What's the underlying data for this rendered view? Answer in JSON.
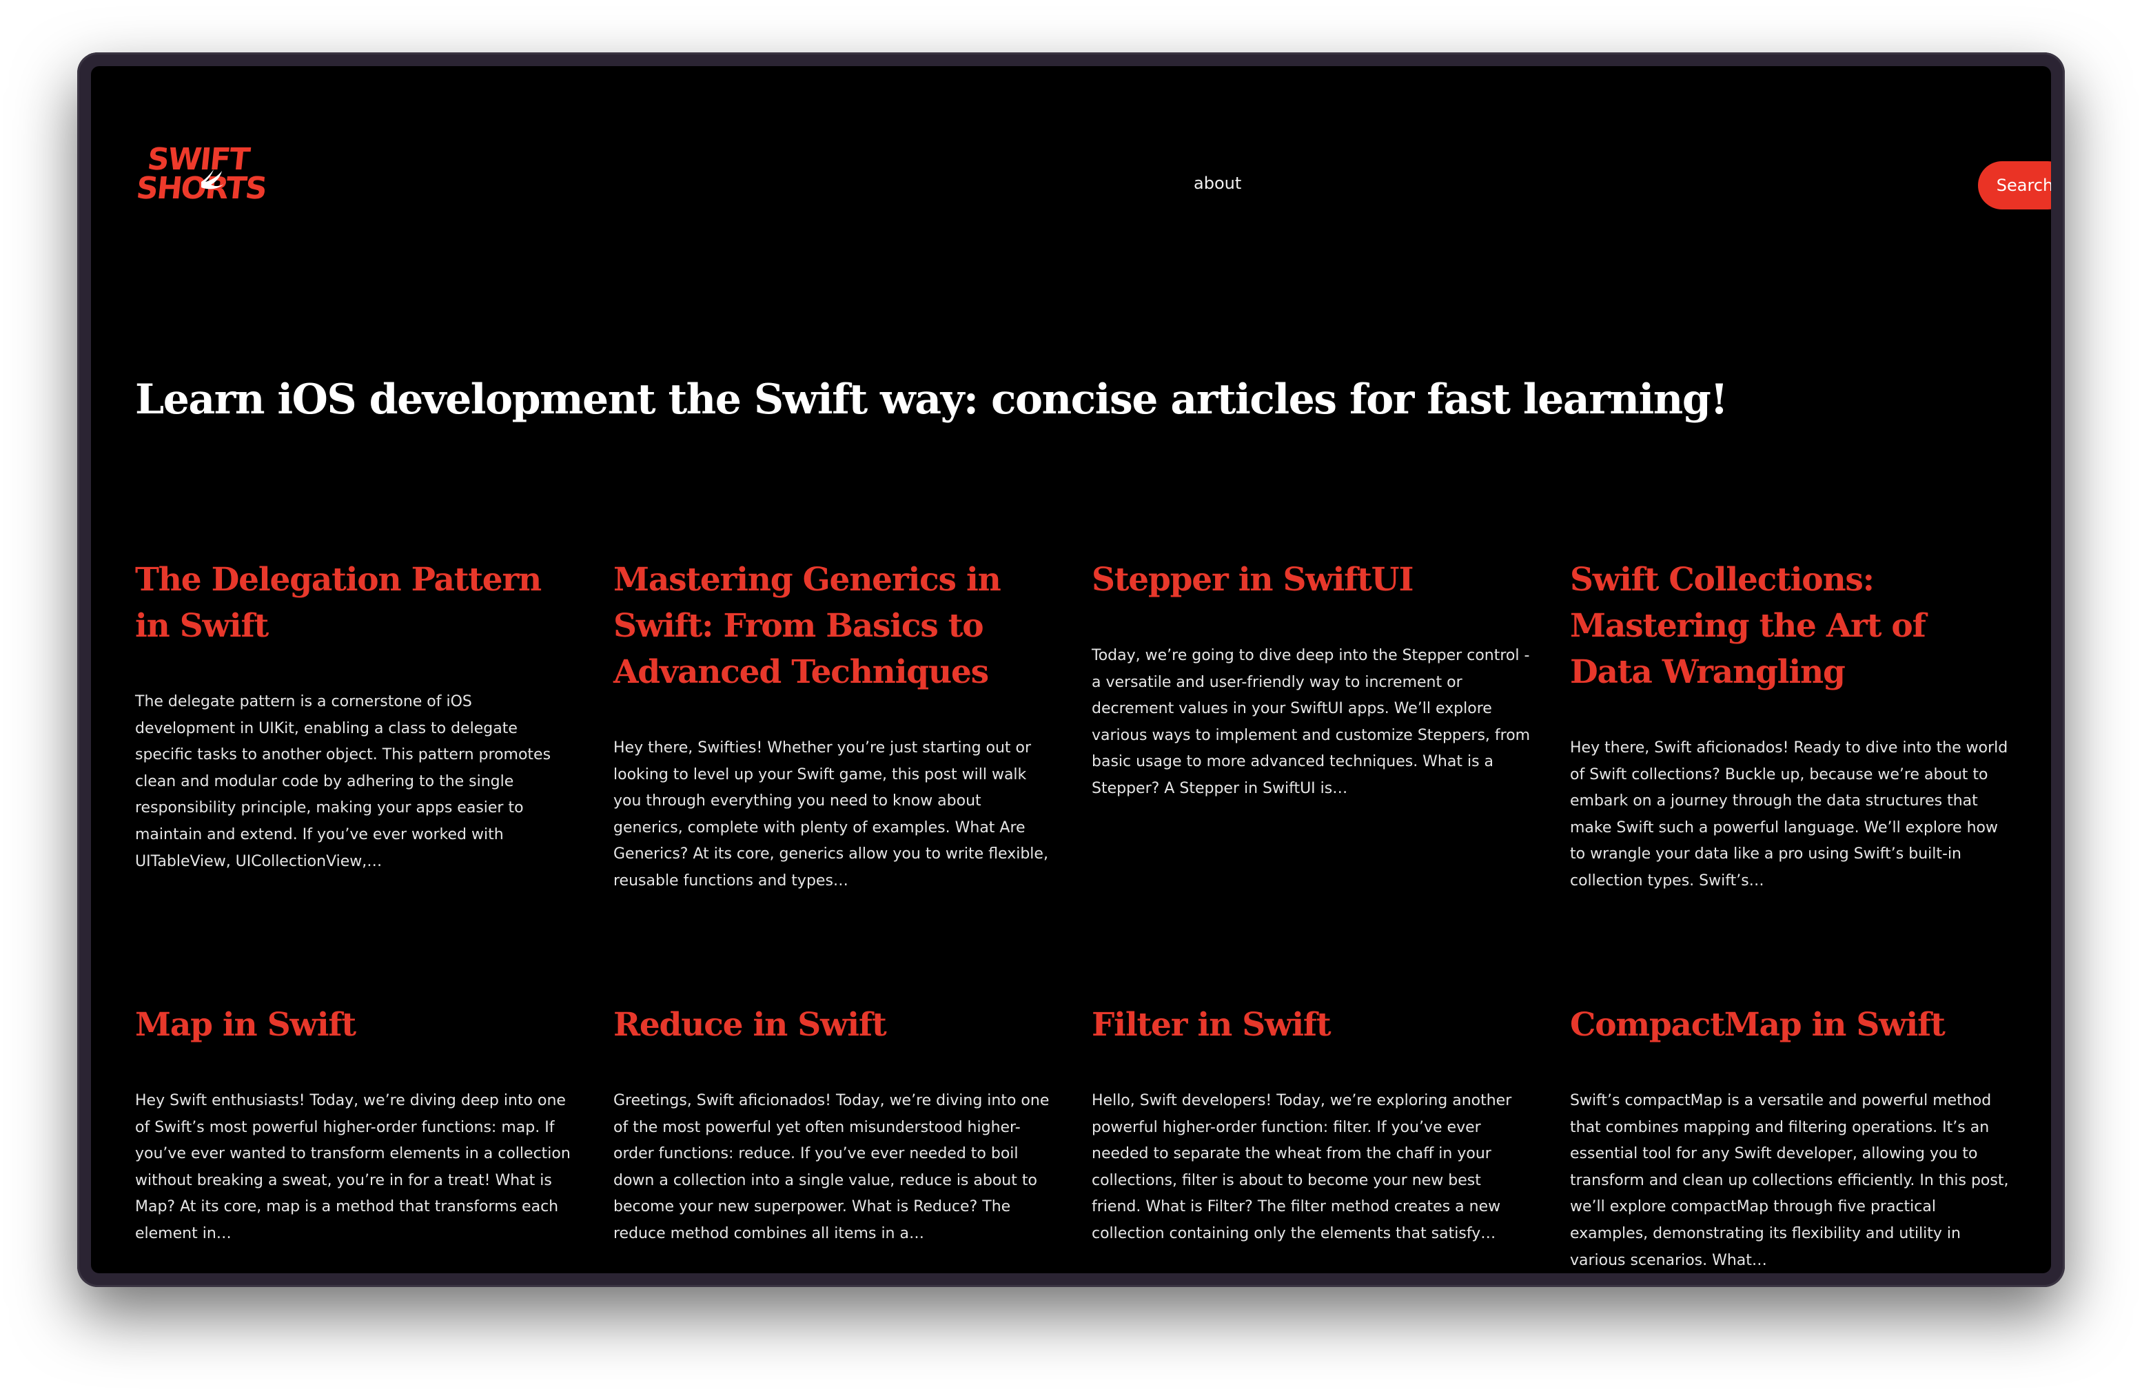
{
  "brand": {
    "logo_line1": "SWIFT",
    "logo_line2": "SHORTS",
    "accent_color": "#ea3325",
    "logo_icon": "swift-bird-icon"
  },
  "nav": {
    "about_label": "about",
    "search_label": "Search"
  },
  "headline": "Learn iOS development the Swift way: concise articles for fast learning!",
  "articles": [
    {
      "title": "The Delegation Pattern in Swift",
      "excerpt": "The delegate pattern is a cornerstone of iOS development in UIKit, enabling a class to delegate specific tasks to another object. This pattern promotes clean and modular code by adhering to the single responsibility principle, making your apps easier to maintain and extend. If you’ve ever worked with UITableView, UICollectionView,…"
    },
    {
      "title": "Mastering Generics in Swift: From Basics to Advanced Techniques",
      "excerpt": "Hey there, Swifties! Whether you’re just starting out or looking to level up your Swift game, this post will walk you through everything you need to know about generics, complete with plenty of examples. What Are Generics? At its core, generics allow you to write flexible, reusable functions and types…"
    },
    {
      "title": "Stepper in SwiftUI",
      "excerpt": "Today, we’re going to dive deep into the Stepper control - a versatile and user-friendly way to increment or decrement values in your SwiftUI apps. We’ll explore various ways to implement and customize Steppers, from basic usage to more advanced techniques. What is a Stepper? A Stepper in SwiftUI is…"
    },
    {
      "title": "Swift Collections: Mastering the Art of Data Wrangling",
      "excerpt": "Hey there, Swift aficionados! Ready to dive into the world of Swift collections? Buckle up, because we’re about to embark on a journey through the data structures that make Swift such a powerful language. We’ll explore how to wrangle your data like a pro using Swift’s built-in collection types. Swift’s…"
    },
    {
      "title": "Map in Swift",
      "excerpt": "Hey Swift enthusiasts! Today, we’re diving deep into one of Swift’s most powerful higher-order functions: map. If you’ve ever wanted to transform elements in a collection without breaking a sweat, you’re in for a treat! What is Map? At its core, map is a method that transforms each element in…"
    },
    {
      "title": "Reduce in Swift",
      "excerpt": "Greetings, Swift aficionados! Today, we’re diving into one of the most powerful yet often misunderstood higher-order functions: reduce. If you’ve ever needed to boil down a collection into a single value, reduce is about to become your new superpower. What is Reduce? The reduce method combines all items in a…"
    },
    {
      "title": "Filter in Swift",
      "excerpt": "Hello, Swift developers! Today, we’re exploring another powerful higher-order function: filter. If you’ve ever needed to separate the wheat from the chaff in your collections, filter is about to become your new best friend. What is Filter? The filter method creates a new collection containing only the elements that satisfy…"
    },
    {
      "title": "CompactMap in Swift",
      "excerpt": "Swift’s compactMap is a versatile and powerful method that combines mapping and filtering operations. It’s an essential tool for any Swift developer, allowing you to transform and clean up collections efficiently. In this post, we’ll explore compactMap through five practical examples, demonstrating its flexibility and utility in various scenarios. What…"
    }
  ]
}
